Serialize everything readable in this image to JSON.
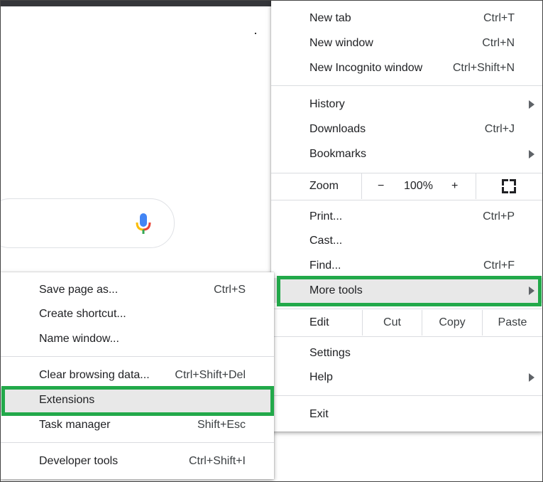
{
  "main_menu": {
    "items": [
      {
        "label": "New tab",
        "shortcut": "Ctrl+T"
      },
      {
        "label": "New window",
        "shortcut": "Ctrl+N"
      },
      {
        "label": "New Incognito window",
        "shortcut": "Ctrl+Shift+N"
      },
      {
        "label": "History",
        "shortcut": ""
      },
      {
        "label": "Downloads",
        "shortcut": "Ctrl+J"
      },
      {
        "label": "Bookmarks",
        "shortcut": ""
      },
      {
        "label": "Print...",
        "shortcut": "Ctrl+P"
      },
      {
        "label": "Cast...",
        "shortcut": ""
      },
      {
        "label": "Find...",
        "shortcut": "Ctrl+F"
      },
      {
        "label": "More tools",
        "shortcut": ""
      },
      {
        "label": "Settings",
        "shortcut": ""
      },
      {
        "label": "Help",
        "shortcut": ""
      },
      {
        "label": "Exit",
        "shortcut": ""
      }
    ],
    "zoom": {
      "label": "Zoom",
      "minus": "−",
      "value": "100%",
      "plus": "+"
    },
    "edit": {
      "label": "Edit",
      "cut": "Cut",
      "copy": "Copy",
      "paste": "Paste"
    }
  },
  "sub_menu": {
    "items": [
      {
        "label": "Save page as...",
        "shortcut": "Ctrl+S"
      },
      {
        "label": "Create shortcut...",
        "shortcut": ""
      },
      {
        "label": "Name window...",
        "shortcut": ""
      },
      {
        "label": "Clear browsing data...",
        "shortcut": "Ctrl+Shift+Del"
      },
      {
        "label": "Extensions",
        "shortcut": ""
      },
      {
        "label": "Task manager",
        "shortcut": "Shift+Esc"
      },
      {
        "label": "Developer tools",
        "shortcut": "Ctrl+Shift+I"
      }
    ]
  },
  "icons": {
    "mic": "microphone-icon",
    "fullscreen": "fullscreen-icon",
    "submenu_arrow": "chevron-right-icon"
  },
  "colors": {
    "highlight_border": "#22a94a",
    "selected_bg": "#e8e8e8"
  }
}
